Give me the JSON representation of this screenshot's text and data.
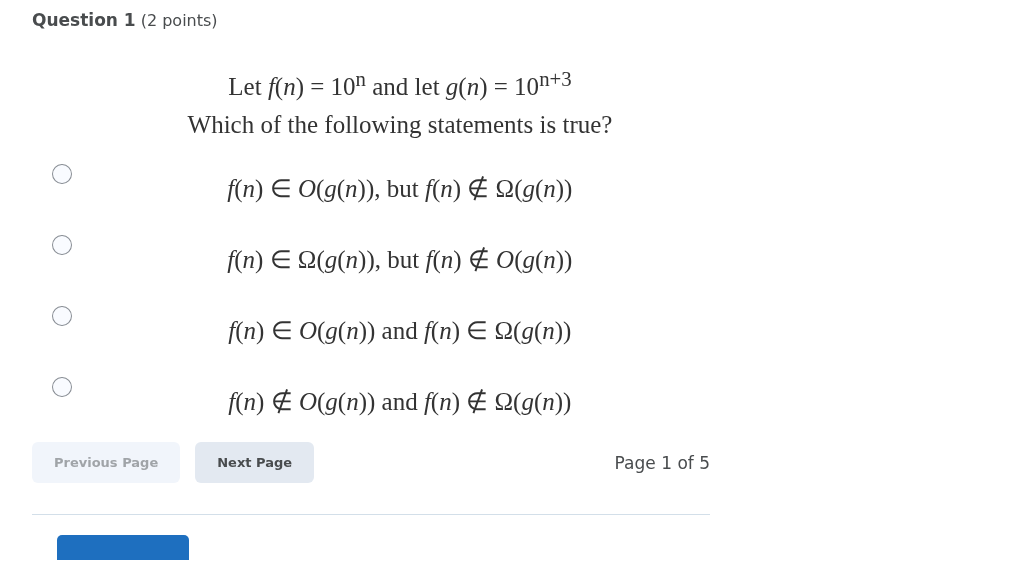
{
  "question": {
    "title": "Question 1",
    "points": "(2 points)"
  },
  "stem": [
    "Let *f*(*n*) = 10$^{n}$ and let *g*(*n*) = 10$^{n+3}$",
    "Which of the following statements is true?"
  ],
  "options": [
    {
      "text": "*f*(*n*) ∈ *O*(*g*(*n*)),  but *f*(*n*) ∉ Ω(*g*(*n*))",
      "selected": false
    },
    {
      "text": "*f*(*n*) ∈ Ω(*g*(*n*)),  but *f*(*n*) ∉ *O*(*g*(*n*))",
      "selected": false
    },
    {
      "text": "*f*(*n*) ∈ *O*(*g*(*n*)) and *f*(*n*) ∈ Ω(*g*(*n*))",
      "selected": false
    },
    {
      "text": "*f*(*n*) ∉ *O*(*g*(*n*)) and *f*(*n*) ∉ Ω(*g*(*n*))",
      "selected": false
    }
  ],
  "pager": {
    "buttons": [
      {
        "label": "Previous Page",
        "disabled": true
      },
      {
        "label": "Next Page",
        "disabled": false
      }
    ],
    "status": "Page 1 of 5"
  }
}
